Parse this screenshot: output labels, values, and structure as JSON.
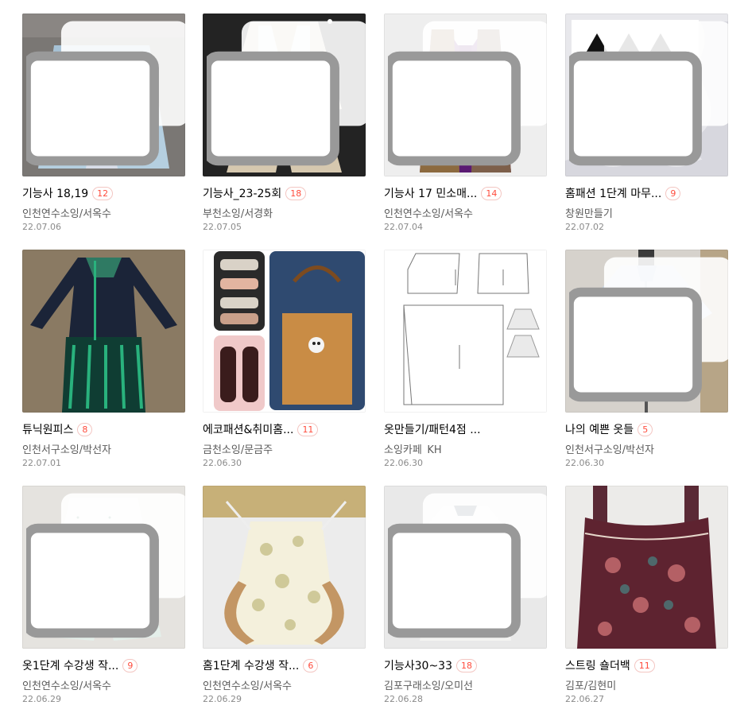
{
  "posts": [
    {
      "title": "기능사 18,19",
      "comments": "12",
      "author": "인천연수소잉/서옥수",
      "date": "22.07.06"
    },
    {
      "title": "기능사_23-25회",
      "comments": "18",
      "author": "부천소잉/서경화",
      "date": "22.07.05"
    },
    {
      "title": "기능사 17 민소매...",
      "comments": "14",
      "author": "인천연수소잉/서옥수",
      "date": "22.07.04"
    },
    {
      "title": "홈패션 1단계 마무...",
      "comments": "9",
      "author": "창원만들기",
      "date": "22.07.02"
    },
    {
      "title": "튜닉원피스",
      "comments": "8",
      "author": "인천서구소잉/박선자",
      "date": "22.07.01"
    },
    {
      "title": "에코패션&취미홈...",
      "comments": "11",
      "author": "금천소잉/문금주",
      "date": "22.06.30"
    },
    {
      "title": "옷만들기/패턴4점 ...",
      "comments": "",
      "author": "소잉카페_KH",
      "date": "22.06.30"
    },
    {
      "title": "나의 예쁜 옷들",
      "comments": "5",
      "author": "인천서구소잉/박선자",
      "date": "22.06.30"
    },
    {
      "title": "옷1단계 수강생 작...",
      "comments": "9",
      "author": "인천연수소잉/서옥수",
      "date": "22.06.29"
    },
    {
      "title": "홈1단계 수강생 작...",
      "comments": "6",
      "author": "인천연수소잉/서옥수",
      "date": "22.06.29"
    },
    {
      "title": "기능사30~33",
      "comments": "18",
      "author": "김포구래소잉/오미선",
      "date": "22.06.28"
    },
    {
      "title": "스트링 숄더백",
      "comments": "11",
      "author": "김포/김현미",
      "date": "22.06.27"
    }
  ],
  "icons": {
    "multi_image": "multi-image-icon"
  },
  "colors": {
    "badge": "#ff4b3c",
    "author": "#5b5b5b",
    "date": "#8a8a8a"
  }
}
